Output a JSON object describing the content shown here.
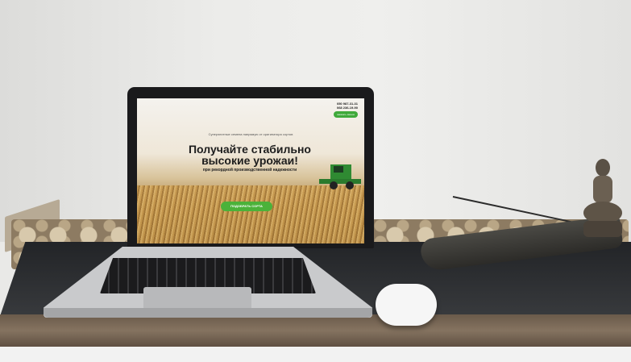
{
  "scene": {
    "description": ""
  },
  "website": {
    "intro_text": "",
    "phones": [
      "050 987-31-31",
      "068 236-19-90"
    ],
    "callback_button": "заказать звонок",
    "tagline": "Суперэлитные семена напрямую от оригинатора сортов",
    "headline": "Получайте стабильно высокие урожаи!",
    "subheadline": "при рекордной производственной надежности",
    "cta_button": "ПОДОБРАТЬ СОРТА"
  }
}
